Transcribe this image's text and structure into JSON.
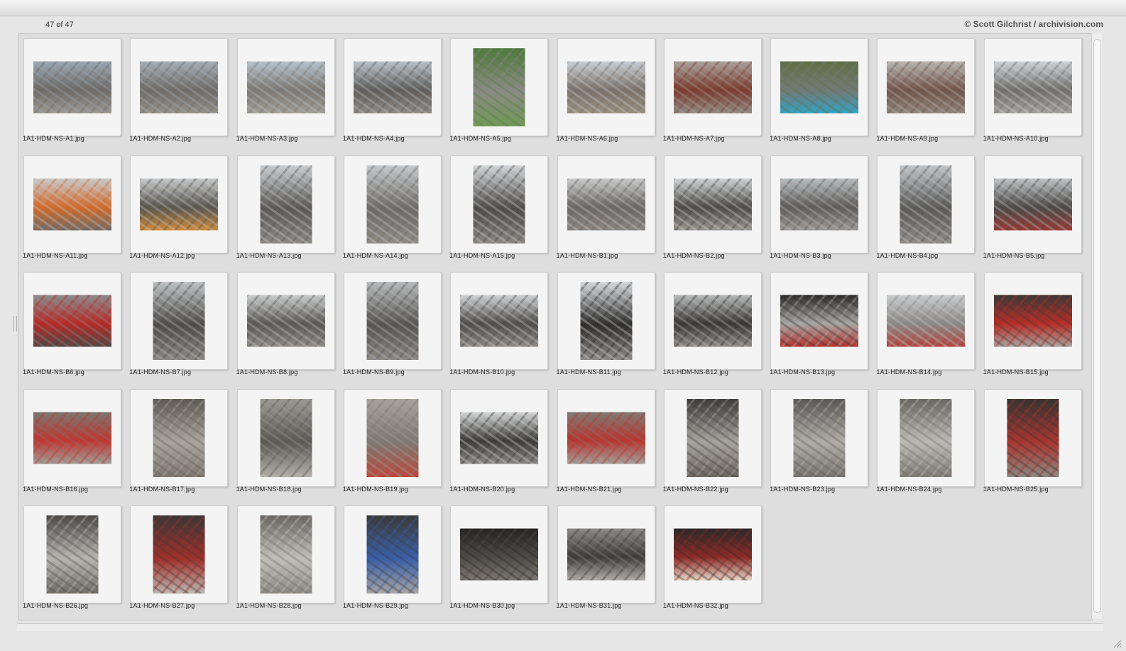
{
  "header": {
    "count": "47 of 47",
    "credit": "© Scott Gilchrist / archivision.com"
  },
  "thumbnails": [
    {
      "file": "1A1-HDM-NS-A1.jpg",
      "orient": "land",
      "colors": [
        "#9aa7b3",
        "#6e6a66",
        "#9c9891"
      ]
    },
    {
      "file": "1A1-HDM-NS-A2.jpg",
      "orient": "land",
      "colors": [
        "#a5aeb6",
        "#6f6c68",
        "#948f88"
      ]
    },
    {
      "file": "1A1-HDM-NS-A3.jpg",
      "orient": "land",
      "colors": [
        "#b6c2cc",
        "#7c7872",
        "#a19d95"
      ]
    },
    {
      "file": "1A1-HDM-NS-A4.jpg",
      "orient": "land",
      "colors": [
        "#b9c1c8",
        "#5f5d5b",
        "#908b84"
      ]
    },
    {
      "file": "1A1-HDM-NS-A5.jpg",
      "orient": "port",
      "colors": [
        "#4f7a3d",
        "#8c8a86",
        "#6f9a52"
      ]
    },
    {
      "file": "1A1-HDM-NS-A6.jpg",
      "orient": "land",
      "colors": [
        "#c9ced3",
        "#7a716a",
        "#9a8f7e"
      ]
    },
    {
      "file": "1A1-HDM-NS-A7.jpg",
      "orient": "land",
      "colors": [
        "#a8a29a",
        "#7b3b2f",
        "#8f8a84"
      ]
    },
    {
      "file": "1A1-HDM-NS-A8.jpg",
      "orient": "land",
      "colors": [
        "#5f7046",
        "#747a76",
        "#2ea4c8"
      ]
    },
    {
      "file": "1A1-HDM-NS-A9.jpg",
      "orient": "land",
      "colors": [
        "#b7b4b0",
        "#70554a",
        "#8e857c"
      ]
    },
    {
      "file": "1A1-HDM-NS-A10.jpg",
      "orient": "land",
      "colors": [
        "#cfd2d5",
        "#6f6e6c",
        "#a3a09c"
      ]
    },
    {
      "file": "1A1-HDM-NS-A11.jpg",
      "orient": "land",
      "colors": [
        "#c7c9cb",
        "#d06a2a",
        "#6c6a68"
      ]
    },
    {
      "file": "1A1-HDM-NS-A12.jpg",
      "orient": "land",
      "colors": [
        "#c6c8ca",
        "#58564f",
        "#d18a3a"
      ]
    },
    {
      "file": "1A1-HDM-NS-A13.jpg",
      "orient": "port",
      "colors": [
        "#c9cccf",
        "#5a5855",
        "#8d8a86"
      ]
    },
    {
      "file": "1A1-HDM-NS-A14.jpg",
      "orient": "port",
      "colors": [
        "#c5c8cb",
        "#6d6a66",
        "#8f8b85"
      ]
    },
    {
      "file": "1A1-HDM-NS-A15.jpg",
      "orient": "port",
      "colors": [
        "#d1d3d5",
        "#4e4c4a",
        "#8a8682"
      ]
    },
    {
      "file": "1A1-HDM-NS-B1.jpg",
      "orient": "land",
      "colors": [
        "#c8c9ca",
        "#6a6764",
        "#8d8781"
      ]
    },
    {
      "file": "1A1-HDM-NS-B2.jpg",
      "orient": "land",
      "colors": [
        "#cfd1d3",
        "#4d4b48",
        "#9a9691"
      ]
    },
    {
      "file": "1A1-HDM-NS-B3.jpg",
      "orient": "land",
      "colors": [
        "#b9bcbe",
        "#5e5c5a",
        "#9c9895"
      ]
    },
    {
      "file": "1A1-HDM-NS-B4.jpg",
      "orient": "port",
      "colors": [
        "#c2c5c8",
        "#5b5a58",
        "#8f8c88"
      ]
    },
    {
      "file": "1A1-HDM-NS-B5.jpg",
      "orient": "land",
      "colors": [
        "#c0c2c4",
        "#4c4a48",
        "#9b3a33"
      ]
    },
    {
      "file": "1A1-HDM-NS-B6.jpg",
      "orient": "land",
      "colors": [
        "#8a8c8e",
        "#b52a25",
        "#4a4847"
      ]
    },
    {
      "file": "1A1-HDM-NS-B7.jpg",
      "orient": "port",
      "colors": [
        "#bfc2c4",
        "#4e4c4a",
        "#8a8783"
      ]
    },
    {
      "file": "1A1-HDM-NS-B8.jpg",
      "orient": "land",
      "colors": [
        "#c9cbcc",
        "#5a5856",
        "#8e8b87"
      ]
    },
    {
      "file": "1A1-HDM-NS-B9.jpg",
      "orient": "port",
      "colors": [
        "#b8babb",
        "#565452",
        "#8c8985"
      ]
    },
    {
      "file": "1A1-HDM-NS-B10.jpg",
      "orient": "land",
      "colors": [
        "#cfd1d3",
        "#4f4d4b",
        "#8e8a86"
      ]
    },
    {
      "file": "1A1-HDM-NS-B11.jpg",
      "orient": "port",
      "colors": [
        "#d6d8da",
        "#2f2e2d",
        "#8e8a86"
      ]
    },
    {
      "file": "1A1-HDM-NS-B12.jpg",
      "orient": "land",
      "colors": [
        "#b8b9ba",
        "#3a3836",
        "#8f8c88"
      ]
    },
    {
      "file": "1A1-HDM-NS-B13.jpg",
      "orient": "land",
      "colors": [
        "#2d2c2b",
        "#a9a7a4",
        "#b6322c"
      ]
    },
    {
      "file": "1A1-HDM-NS-B14.jpg",
      "orient": "land",
      "colors": [
        "#c9cbcd",
        "#8a8885",
        "#b5403a"
      ]
    },
    {
      "file": "1A1-HDM-NS-B15.jpg",
      "orient": "land",
      "colors": [
        "#3a3937",
        "#b82d27",
        "#a8a5a1"
      ]
    },
    {
      "file": "1A1-HDM-NS-B16.jpg",
      "orient": "land",
      "colors": [
        "#7a7670",
        "#c03630",
        "#a5a09a"
      ]
    },
    {
      "file": "1A1-HDM-NS-B17.jpg",
      "orient": "port",
      "colors": [
        "#5e5a55",
        "#a9a49e",
        "#7e7770"
      ]
    },
    {
      "file": "1A1-HDM-NS-B18.jpg",
      "orient": "port",
      "colors": [
        "#9c9893",
        "#5c5955",
        "#b5b1ab"
      ]
    },
    {
      "file": "1A1-HDM-NS-B19.jpg",
      "orient": "port",
      "colors": [
        "#a6a29c",
        "#7d7870",
        "#c0443a"
      ]
    },
    {
      "file": "1A1-HDM-NS-B20.jpg",
      "orient": "land",
      "colors": [
        "#d4d5d6",
        "#3d3c3a",
        "#8c8985"
      ]
    },
    {
      "file": "1A1-HDM-NS-B21.jpg",
      "orient": "land",
      "colors": [
        "#7f7a74",
        "#b8342e",
        "#a6a29d"
      ]
    },
    {
      "file": "1A1-HDM-NS-B22.jpg",
      "orient": "port",
      "colors": [
        "#3e3c3a",
        "#a7a39e",
        "#6a6560"
      ]
    },
    {
      "file": "1A1-HDM-NS-B23.jpg",
      "orient": "port",
      "colors": [
        "#5a5855",
        "#b1ada8",
        "#76726d"
      ]
    },
    {
      "file": "1A1-HDM-NS-B24.jpg",
      "orient": "port",
      "colors": [
        "#6b6864",
        "#bdb9b4",
        "#7e7a74"
      ]
    },
    {
      "file": "1A1-HDM-NS-B25.jpg",
      "orient": "port",
      "colors": [
        "#353331",
        "#a9362f",
        "#8d8984"
      ]
    },
    {
      "file": "1A1-HDM-NS-B26.jpg",
      "orient": "port",
      "colors": [
        "#4c4a48",
        "#b8b4af",
        "#6f6b66"
      ]
    },
    {
      "file": "1A1-HDM-NS-B27.jpg",
      "orient": "port",
      "colors": [
        "#3a3836",
        "#a02f2a",
        "#bcb8b3"
      ]
    },
    {
      "file": "1A1-HDM-NS-B28.jpg",
      "orient": "port",
      "colors": [
        "#6a6763",
        "#c2beb9",
        "#8b8782"
      ]
    },
    {
      "file": "1A1-HDM-NS-B29.jpg",
      "orient": "port",
      "colors": [
        "#3c3a38",
        "#3a5fa8",
        "#a9a5a0"
      ]
    },
    {
      "file": "1A1-HDM-NS-B30.jpg",
      "orient": "land",
      "colors": [
        "#262524",
        "#4e4b47",
        "#7d7871"
      ]
    },
    {
      "file": "1A1-HDM-NS-B31.jpg",
      "orient": "land",
      "colors": [
        "#8d8984",
        "#3e3c3a",
        "#b3afaa"
      ]
    },
    {
      "file": "1A1-HDM-NS-B32.jpg",
      "orient": "land",
      "colors": [
        "#2a2928",
        "#8e2b26",
        "#e3d8c8"
      ]
    }
  ]
}
